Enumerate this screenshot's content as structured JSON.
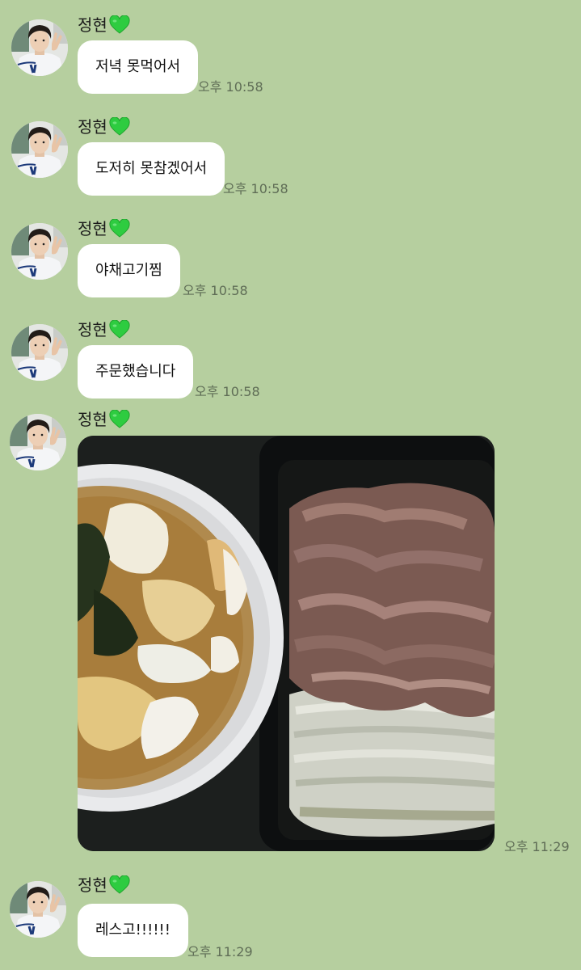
{
  "chat": {
    "sender_name": "정현",
    "messages": [
      {
        "type": "text",
        "text": "저녁 못먹어서",
        "time": "오후 10:58"
      },
      {
        "type": "text",
        "text": "도저히 못참겠어서",
        "time": "오후 10:58"
      },
      {
        "type": "text",
        "text": "야채고기찜",
        "time": "오후 10:58"
      },
      {
        "type": "text",
        "text": "주문했습니다",
        "time": "오후 10:58"
      },
      {
        "type": "image",
        "image_description": "photo of soup bowl and steamed beef with napa cabbage",
        "time": "오후 11:29"
      },
      {
        "type": "text",
        "text": "레스고!!!!!!",
        "time": "오후 11:29"
      }
    ]
  },
  "colors": {
    "background": "#b6cf9f",
    "bubble": "#ffffff",
    "heart": "#2ecc40"
  },
  "icons": {
    "sender_emoji": "green-heart-icon",
    "avatar": "profile-avatar"
  }
}
